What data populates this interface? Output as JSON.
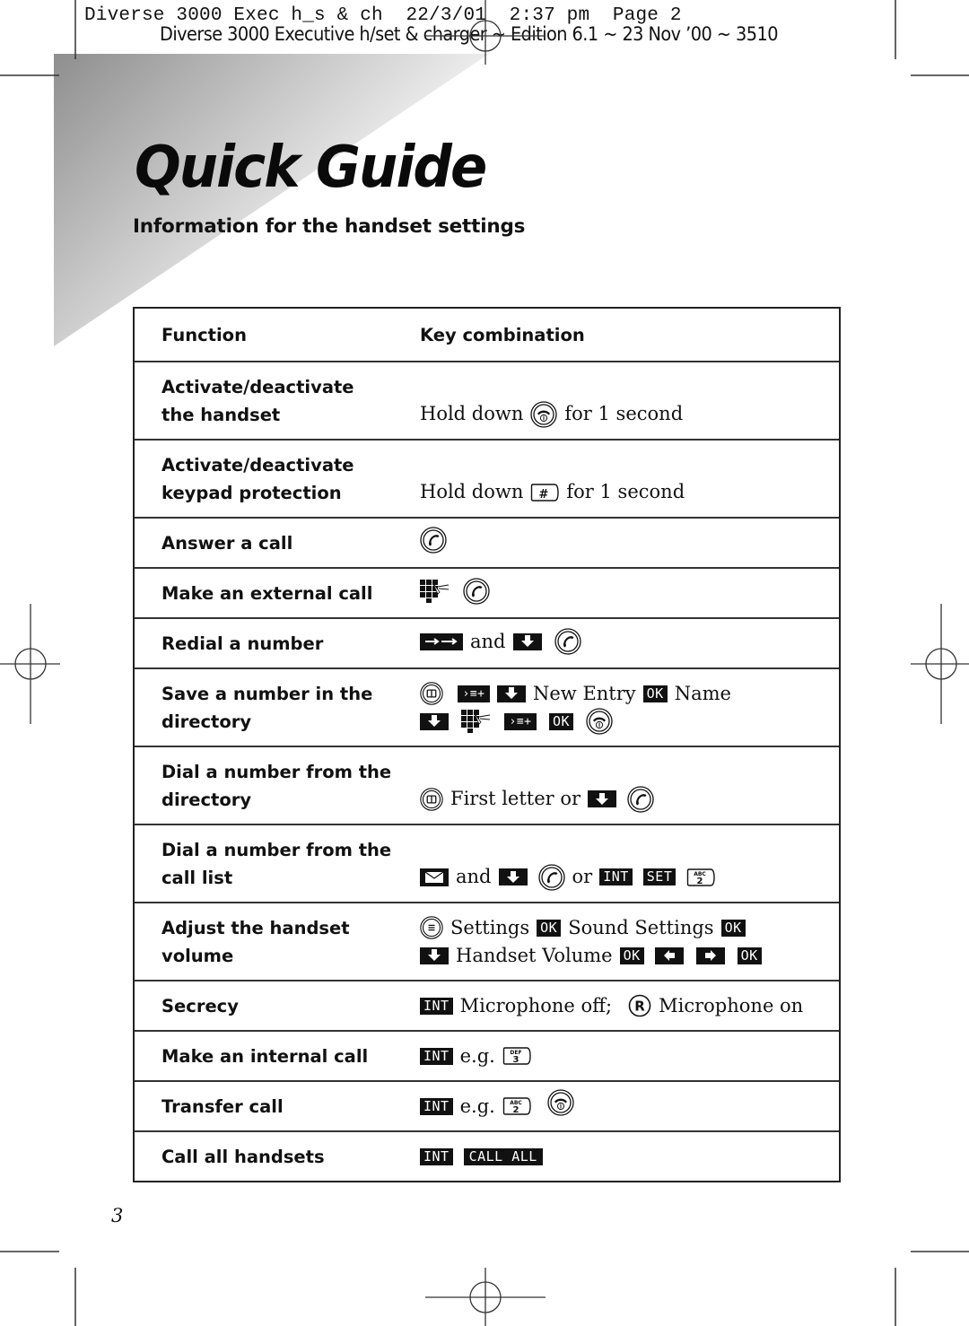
{
  "slug_line": "Diverse 3000 Exec h_s & ch  22/3/01  2:37 pm  Page 2",
  "edition_line": "Diverse 3000 Executive h/set & charger ~ Edition 6.1 ~ 23 Nov ’00 ~ 3510",
  "title": "Quick Guide",
  "subtitle": "Information for the handset settings",
  "table": {
    "headers": {
      "function": "Function",
      "keys": "Key combination"
    },
    "rows": [
      {
        "function_lines": [
          "Activate/deactivate",
          "the handset"
        ],
        "key_text": {
          "before": "Hold down",
          "after": "for 1 second"
        },
        "key_icons": [
          "end-call-button-icon"
        ]
      },
      {
        "function_lines": [
          "Activate/deactivate",
          "keypad protection"
        ],
        "key_text": {
          "before": "Hold down",
          "after": "for 1 second"
        },
        "key_icons": [
          "hash-key-icon"
        ]
      },
      {
        "function_lines": [
          "Answer a call"
        ],
        "key_icons": [
          "call-button-icon"
        ]
      },
      {
        "function_lines": [
          "Make an external call"
        ],
        "key_icons": [
          "keypad-dial-icon",
          "call-button-icon"
        ]
      },
      {
        "function_lines": [
          "Redial a number"
        ],
        "key_text": {
          "and": "and"
        },
        "key_icons": [
          "redial-softkey-icon",
          "down-arrow-softkey-icon",
          "call-button-icon"
        ]
      },
      {
        "function_lines": [
          "Save a number in the",
          "directory"
        ],
        "key_text": {
          "new_entry": "New Entry",
          "ok": "OK",
          "name": "Name"
        },
        "key_icons": [
          "directory-button-icon",
          "add-entry-softkey-icon",
          "down-arrow-softkey-icon",
          "ok-softkey-icon",
          "down-arrow-softkey-icon",
          "keypad-dial-icon",
          "add-entry-softkey-icon",
          "ok-softkey-icon",
          "end-call-button-icon"
        ]
      },
      {
        "function_lines": [
          "Dial a number from the",
          "directory"
        ],
        "key_text": {
          "first_letter": "First letter or"
        },
        "key_icons": [
          "directory-button-icon",
          "down-arrow-softkey-icon",
          "call-button-icon"
        ]
      },
      {
        "function_lines": [
          "Dial a number from the",
          "call list"
        ],
        "key_text": {
          "and": "and",
          "or": "or",
          "int": "INT",
          "set": "SET",
          "key2_letters": "ABC",
          "key2_digit": "2"
        },
        "key_icons": [
          "envelope-softkey-icon",
          "down-arrow-softkey-icon",
          "call-button-icon",
          "int-softkey-icon",
          "set-softkey-icon",
          "key-2-icon"
        ]
      },
      {
        "function_lines": [
          "Adjust the handset",
          "volume"
        ],
        "key_text": {
          "settings": "Settings",
          "ok": "OK",
          "sound_settings": "Sound Settings",
          "handset_volume": "Handset Volume"
        },
        "key_icons": [
          "menu-button-icon",
          "ok-softkey-icon",
          "ok-softkey-icon",
          "down-arrow-softkey-icon",
          "ok-softkey-icon",
          "left-arrow-softkey-icon",
          "right-arrow-softkey-icon",
          "ok-softkey-icon"
        ]
      },
      {
        "function_lines": [
          "Secrecy"
        ],
        "key_text": {
          "int": "INT",
          "mic_off": "Microphone off;",
          "r": "R",
          "mic_on": "Microphone on"
        },
        "key_icons": [
          "int-softkey-icon",
          "recall-r-button-icon"
        ]
      },
      {
        "function_lines": [
          "Make an internal call"
        ],
        "key_text": {
          "int": "INT",
          "eg": "e.g.",
          "key_letters": "DEF",
          "key_digit": "3"
        },
        "key_icons": [
          "int-softkey-icon",
          "key-3-icon"
        ]
      },
      {
        "function_lines": [
          "Transfer call"
        ],
        "key_text": {
          "int": "INT",
          "eg": "e.g.",
          "key_letters": "ABC",
          "key_digit": "2"
        },
        "key_icons": [
          "int-softkey-icon",
          "key-2-icon",
          "end-call-button-icon"
        ]
      },
      {
        "function_lines": [
          "Call all handsets"
        ],
        "key_text": {
          "int": "INT",
          "call_all": "CALL ALL"
        },
        "key_icons": [
          "int-softkey-icon",
          "call-all-softkey-icon"
        ]
      }
    ]
  },
  "page_number": "3",
  "colors": {
    "ink": "#111111",
    "gradient_dark": "#8e8e8e",
    "paper": "#ffffff"
  }
}
